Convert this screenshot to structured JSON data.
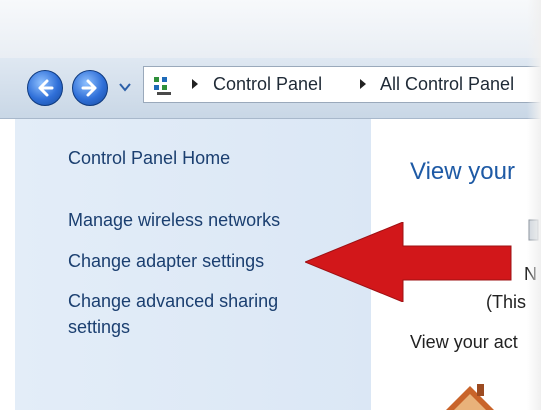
{
  "address": {
    "crumbs": [
      "Control Panel",
      "All Control Panel"
    ]
  },
  "sidebar": {
    "home_link": "Control Panel Home",
    "links": [
      "Manage wireless networks",
      "Change adapter settings",
      "Change advanced sharing settings"
    ]
  },
  "main": {
    "title": "View your",
    "line1": "N",
    "line2": "(This",
    "subheading": "View your act"
  },
  "colors": {
    "arrow": "#d2171a",
    "link": "#1b3f70",
    "title": "#1e5aa5"
  },
  "icons": [
    "back-arrow-icon",
    "forward-arrow-icon",
    "history-dropdown-icon",
    "control-panel-icon",
    "network-house-icon"
  ]
}
